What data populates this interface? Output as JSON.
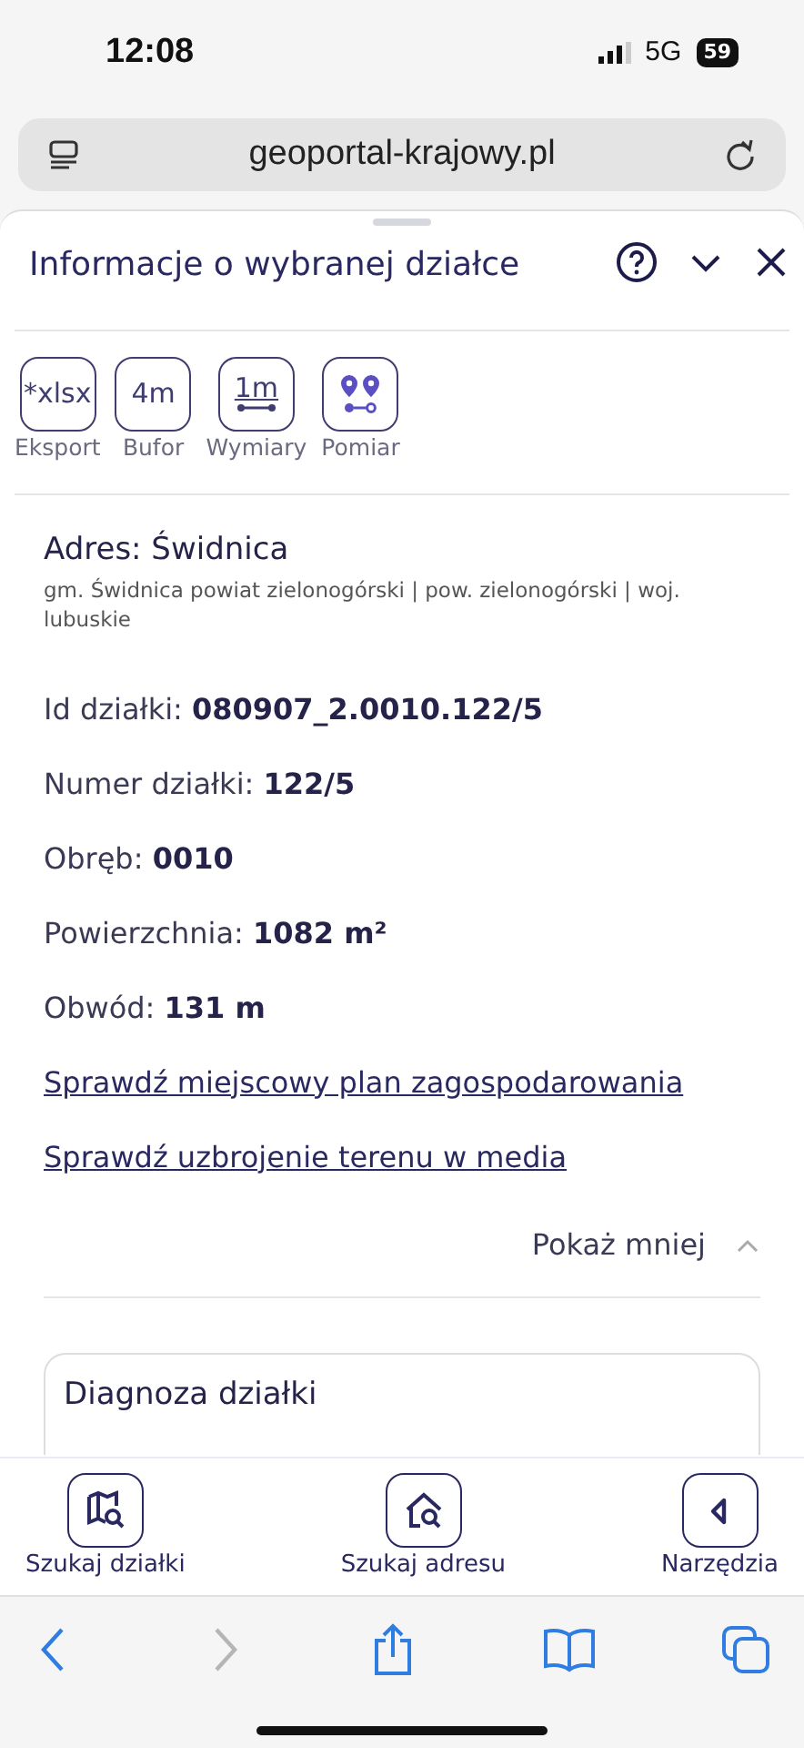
{
  "status_bar": {
    "time": "12:08",
    "network": "5G",
    "battery": "59"
  },
  "browser": {
    "url": "geoportal-krajowy.pl"
  },
  "panel": {
    "title": "Informacje o wybranej działce",
    "tools": [
      {
        "kind": "text",
        "glyph": "*xlsx",
        "label": "Eksport"
      },
      {
        "kind": "text",
        "glyph": "4m",
        "label": "Bufor"
      },
      {
        "kind": "ruler",
        "glyph": "1m",
        "label": "Wymiary"
      },
      {
        "kind": "pins",
        "label": "Pomiar"
      }
    ],
    "address": {
      "title": "Adres: Świdnica",
      "detail": "gm. Świdnica powiat zielonogórski | pow. zielonogórski | woj. lubuskie"
    },
    "fields": [
      {
        "label": "Id działki:",
        "value": "080907_2.0010.122/5"
      },
      {
        "label": "Numer działki:",
        "value": "122/5"
      },
      {
        "label": "Obręb:",
        "value": "0010"
      },
      {
        "label": "Powierzchnia:",
        "value": "1082 m²"
      },
      {
        "label": "Obwód:",
        "value": "131 m"
      }
    ],
    "links": [
      "Sprawdź miejscowy plan zagospodarowania",
      "Sprawdź uzbrojenie terenu w media"
    ],
    "toggle": {
      "label": "Pokaż mniej",
      "expanded": true
    },
    "card_title": "Diagnoza działki"
  },
  "bottom_nav": [
    {
      "kind": "map-search",
      "label": "Szukaj działki"
    },
    {
      "kind": "house-search",
      "label": "Szukaj adresu"
    },
    {
      "kind": "tools",
      "label": "Narzędzia"
    }
  ],
  "safari_toolbar": {
    "back_disabled": false,
    "forward_disabled": true
  }
}
